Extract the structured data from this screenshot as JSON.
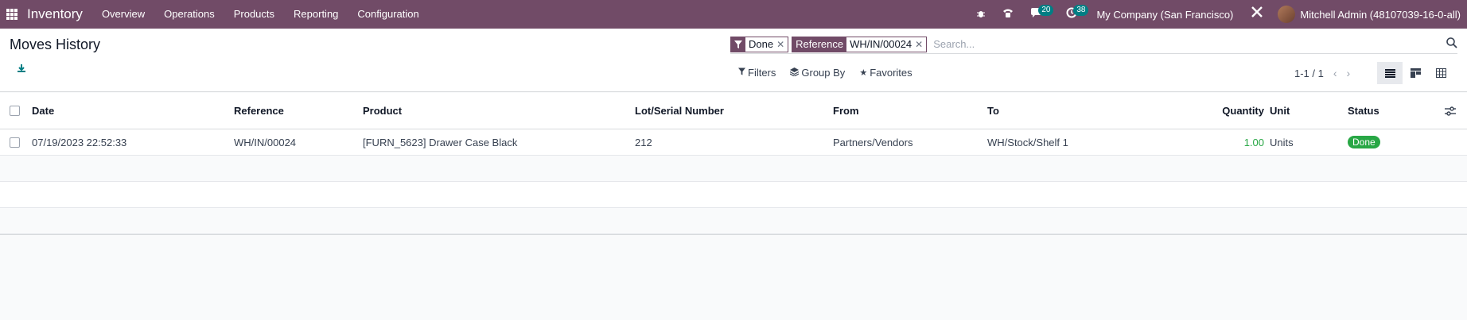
{
  "navbar": {
    "app_name": "Inventory",
    "menu": [
      "Overview",
      "Operations",
      "Products",
      "Reporting",
      "Configuration"
    ],
    "messages_count": "20",
    "activities_count": "38",
    "company": "My Company (San Francisco)",
    "user": "Mitchell Admin (48107039-16-0-all)"
  },
  "control_panel": {
    "title": "Moves History",
    "search": {
      "facets": [
        {
          "label": "",
          "value": "Done"
        },
        {
          "label": "Reference",
          "value": "WH/IN/00024"
        }
      ],
      "placeholder": "Search..."
    },
    "filters_label": "Filters",
    "group_by_label": "Group By",
    "favorites_label": "Favorites",
    "pager": "1-1 / 1"
  },
  "table": {
    "columns": [
      "Date",
      "Reference",
      "Product",
      "Lot/Serial Number",
      "From",
      "To",
      "Quantity",
      "Unit",
      "Status"
    ],
    "rows": [
      {
        "date": "07/19/2023 22:52:33",
        "reference": "WH/IN/00024",
        "product": "[FURN_5623] Drawer Case Black",
        "lot": "212",
        "from": "Partners/Vendors",
        "to": "WH/Stock/Shelf 1",
        "quantity": "1.00",
        "unit": "Units",
        "status": "Done"
      }
    ]
  },
  "colors": {
    "brand": "#714b67",
    "accent": "#017e84",
    "success": "#28a745"
  }
}
